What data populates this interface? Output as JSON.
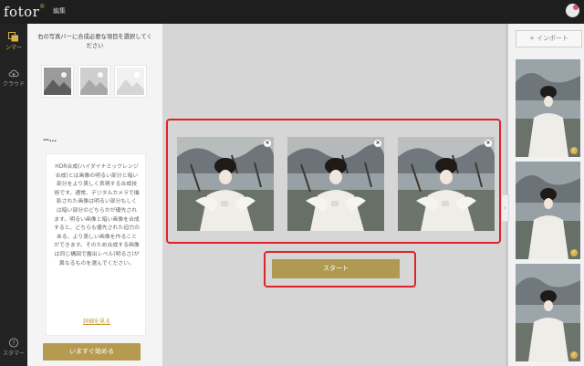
{
  "app": {
    "logo": "fotor",
    "logo_mark": "®",
    "menu_edit": "編集"
  },
  "rail": {
    "items": [
      {
        "label": "ンマー",
        "icon": "collage-icon",
        "active": true
      },
      {
        "label": "クラウド",
        "icon": "cloud-upload-icon",
        "active": false
      },
      {
        "label": "スタマー",
        "icon": "help-icon",
        "active": false
      }
    ]
  },
  "panel": {
    "instruction": "右の写真バーに合成必要な項目を選択してください",
    "section_title": "—...",
    "description": "HDR合成(ハイダイナミックレンジ合成)とは画像の明るい部分と暗い部分をより美しく表現する合成技術です。通常、デジタルカメラで撮影された画像は明るい部分もしくは暗い部分のどちらかが優先されます。明るい画像と暗い画像を合成すると、どちらも優先された迫力のある、より美しい画像を作ることができます。そのため合成する画像は同じ構図で露出レベル(明るさ)が異なるものを選んでください。",
    "detail_link": "詳細を見る",
    "start_now": "いますぐ始める"
  },
  "canvas": {
    "remove_glyph": "×",
    "start_button": "スタート"
  },
  "strip": {
    "import_button": "+ インポート",
    "collapse_glyph": "›",
    "check_glyph": "✓"
  }
}
